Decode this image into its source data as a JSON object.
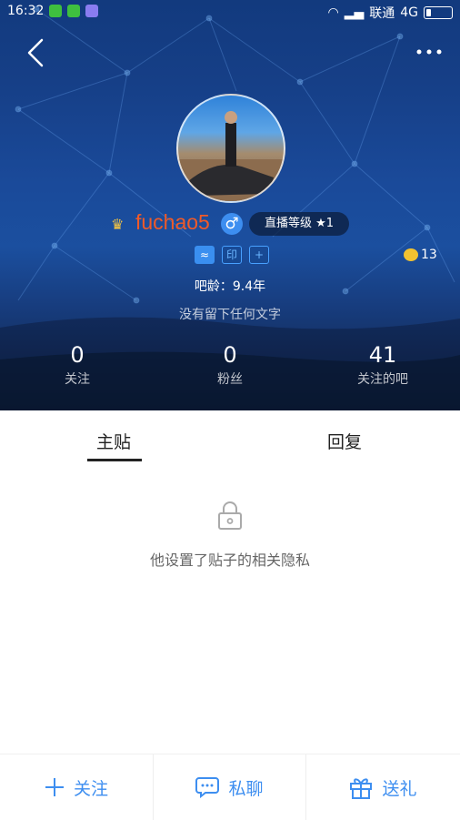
{
  "status_bar": {
    "time": "16:32",
    "carrier": "联通",
    "network": "4G"
  },
  "profile": {
    "username": "fuchao5",
    "gender": "male",
    "level_badge": "直播等级 ★1",
    "medals": [
      "≈",
      "印",
      "+"
    ],
    "tbean_count": "13",
    "bar_age": "吧龄：9.4年",
    "signature": "没有留下任何文字"
  },
  "stats": [
    {
      "value": "0",
      "label": "关注"
    },
    {
      "value": "0",
      "label": "粉丝"
    },
    {
      "value": "41",
      "label": "关注的吧"
    }
  ],
  "tabs": [
    {
      "label": "主贴",
      "active": true
    },
    {
      "label": "回复",
      "active": false
    }
  ],
  "privacy_message": "他设置了贴子的相关隐私",
  "bottom_actions": [
    {
      "label": "关注",
      "icon": "plus-icon"
    },
    {
      "label": "私聊",
      "icon": "chat-bubble-icon"
    },
    {
      "label": "送礼",
      "icon": "gift-icon"
    }
  ],
  "colors": {
    "accent": "#3d8ef0",
    "username": "#f05a28",
    "header_dark": "#0f1f3c"
  }
}
